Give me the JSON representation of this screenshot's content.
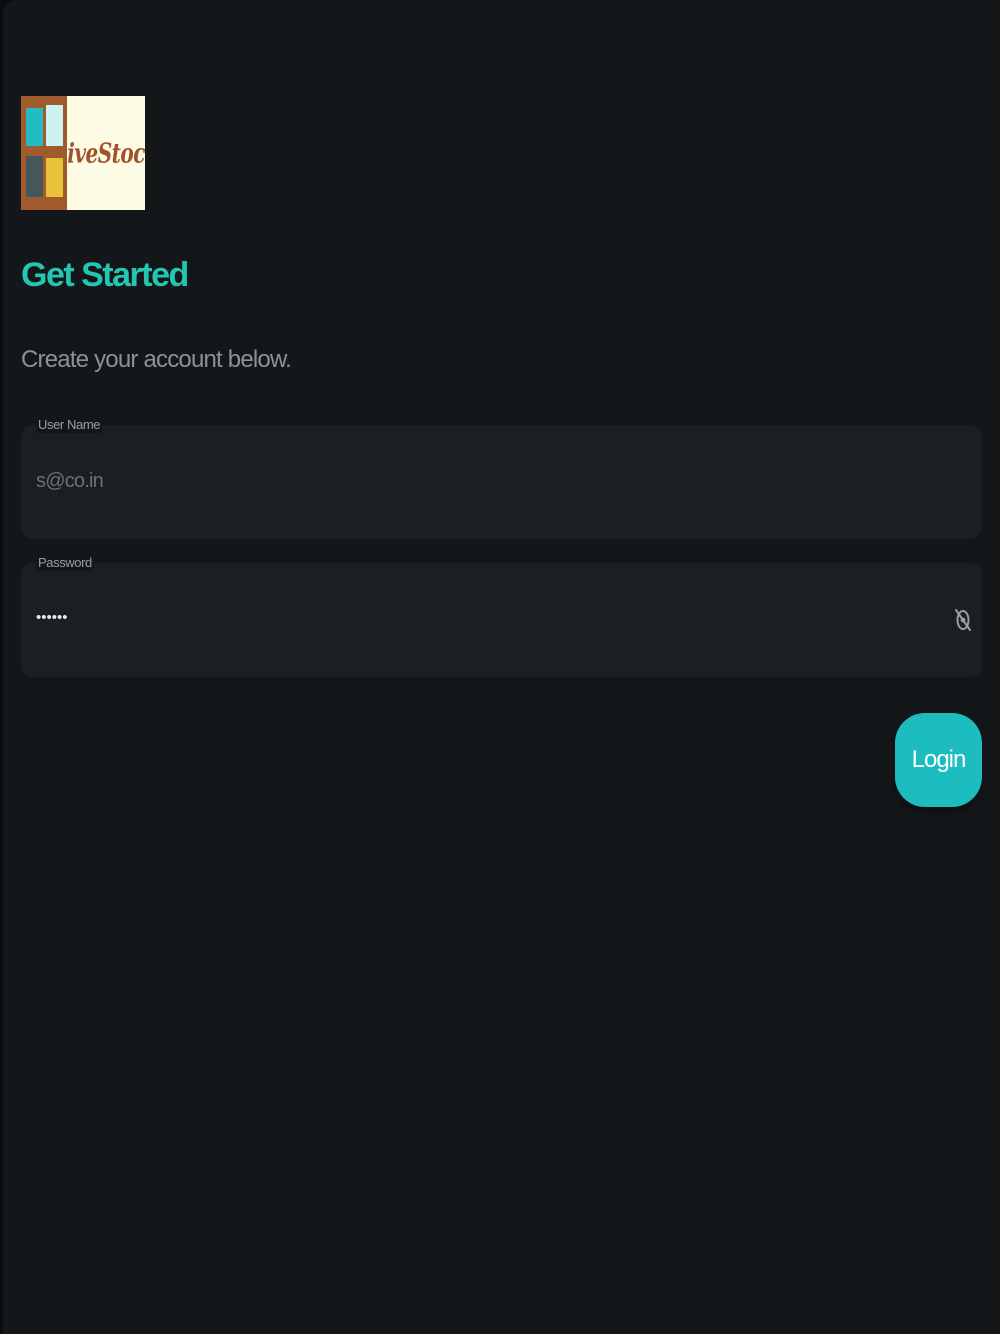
{
  "brand": {
    "logo_text": "LiveStock"
  },
  "header": {
    "title": "Get Started",
    "subtitle": "Create your account below."
  },
  "form": {
    "username": {
      "label": "User Name",
      "value": "s@co.in"
    },
    "password": {
      "label": "Password",
      "value": "••••••",
      "toggle_icon": "eye-off-icon"
    },
    "login_label": "Login"
  },
  "colors": {
    "background": "#14171a",
    "accent": "#24c6b1",
    "button": "#1cbcbf",
    "field_bg": "#1b1e22",
    "muted_text": "#8c9196"
  }
}
